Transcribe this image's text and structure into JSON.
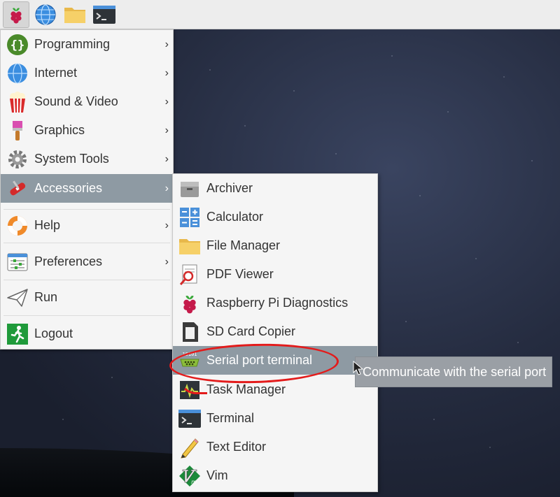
{
  "taskbar": {
    "buttons": [
      {
        "name": "raspberry-menu-button",
        "icon": "raspberry-icon"
      },
      {
        "name": "web-browser-button",
        "icon": "globe-icon"
      },
      {
        "name": "file-manager-button",
        "icon": "folder-icon"
      },
      {
        "name": "terminal-button",
        "icon": "terminal-icon"
      }
    ]
  },
  "main_menu": {
    "items": [
      {
        "label": "Programming",
        "icon": "programming-icon",
        "has_submenu": true
      },
      {
        "label": "Internet",
        "icon": "globe-icon",
        "has_submenu": true
      },
      {
        "label": "Sound & Video",
        "icon": "popcorn-icon",
        "has_submenu": true
      },
      {
        "label": "Graphics",
        "icon": "paintbrush-icon",
        "has_submenu": true
      },
      {
        "label": "System Tools",
        "icon": "gear-icon",
        "has_submenu": true
      },
      {
        "label": "Accessories",
        "icon": "swiss-knife-icon",
        "has_submenu": true,
        "highlighted": true
      },
      {
        "label": "Help",
        "icon": "lifebuoy-icon",
        "has_submenu": true
      },
      {
        "label": "Preferences",
        "icon": "preferences-icon",
        "has_submenu": true
      },
      {
        "label": "Run",
        "icon": "paper-plane-icon",
        "has_submenu": false
      },
      {
        "label": "Logout",
        "icon": "exit-icon",
        "has_submenu": false
      }
    ],
    "submenu_arrow": "›"
  },
  "accessories_submenu": {
    "items": [
      {
        "label": "Archiver",
        "icon": "archive-icon"
      },
      {
        "label": "Calculator",
        "icon": "calculator-icon"
      },
      {
        "label": "File Manager",
        "icon": "folder-icon"
      },
      {
        "label": "PDF Viewer",
        "icon": "pdf-icon"
      },
      {
        "label": "Raspberry Pi Diagnostics",
        "icon": "raspberry-icon"
      },
      {
        "label": "SD Card Copier",
        "icon": "sd-card-icon"
      },
      {
        "label": "Serial port terminal",
        "icon": "serial-port-icon",
        "highlighted": true
      },
      {
        "label": "Task Manager",
        "icon": "task-manager-icon"
      },
      {
        "label": "Terminal",
        "icon": "terminal-icon"
      },
      {
        "label": "Text Editor",
        "icon": "pencil-icon"
      },
      {
        "label": "Vim",
        "icon": "vim-icon"
      }
    ]
  },
  "tooltip": {
    "text": "Communicate with the serial port"
  },
  "colors": {
    "highlight": "#8e9aa3",
    "annotation": "#e31b1b",
    "menu_bg": "#f5f5f5",
    "tooltip_bg": "#9a9fa5"
  }
}
